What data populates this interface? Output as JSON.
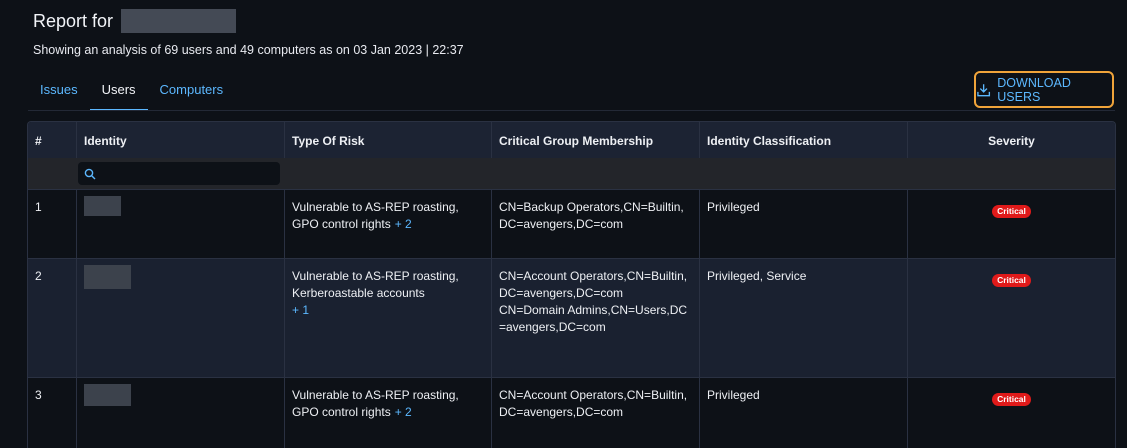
{
  "header": {
    "title_prefix": "Report for",
    "subtitle": "Showing an analysis of 69 users and 49 computers as on 03 Jan 2023 | 22:37"
  },
  "tabs": [
    {
      "label": "Issues",
      "active": false
    },
    {
      "label": "Users",
      "active": true
    },
    {
      "label": "Computers",
      "active": false
    }
  ],
  "download_button": {
    "label": "DOWNLOAD USERS",
    "icon": "download-icon"
  },
  "table": {
    "columns": [
      "#",
      "Identity",
      "Type Of Risk",
      "Critical Group Membership",
      "Identity Classification",
      "Severity"
    ],
    "search_placeholder": "",
    "rows": [
      {
        "index": "1",
        "risk": "Vulnerable to AS-REP roasting,  GPO control rights",
        "risk_more": "+ 2",
        "groups": [
          "CN=Backup Operators,CN=Builtin,DC=avengers,DC=com"
        ],
        "classification": "Privileged",
        "severity": "Critical"
      },
      {
        "index": "2",
        "risk": "Vulnerable to AS-REP roasting,  Kerberoastable accounts",
        "risk_more": "+ 1",
        "groups": [
          "CN=Account Operators,CN=Builtin,DC=avengers,DC=com",
          "CN=Domain Admins,CN=Users,DC=avengers,DC=com"
        ],
        "classification": "Privileged,  Service",
        "severity": "Critical"
      },
      {
        "index": "3",
        "risk": "Vulnerable to AS-REP roasting,  GPO control rights",
        "risk_more": "+ 2",
        "groups": [
          "CN=Account Operators,CN=Builtin,DC=avengers,DC=com"
        ],
        "classification": "Privileged",
        "severity": "Critical"
      }
    ]
  },
  "colors": {
    "accent": "#5cb8ff",
    "critical": "#e01a1a",
    "highlight_border": "#f0a43a"
  }
}
